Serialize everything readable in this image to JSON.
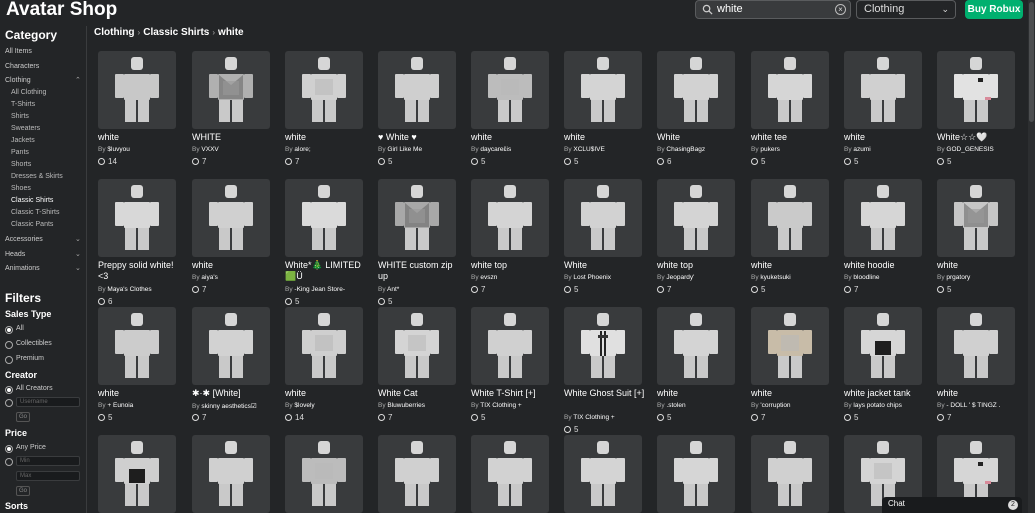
{
  "header": {
    "title": "Avatar Shop",
    "search_value": "white",
    "search_icon": "search-icon",
    "clear_icon": "clear-icon",
    "category_select": "Clothing",
    "buy_robux": "Buy Robux"
  },
  "sidebar": {
    "category_heading": "Category",
    "categories": [
      {
        "label": "All Items"
      },
      {
        "label": "Characters"
      },
      {
        "label": "Clothing"
      }
    ],
    "clothing_sub": [
      {
        "label": "All Clothing"
      },
      {
        "label": "T-Shirts"
      },
      {
        "label": "Shirts"
      },
      {
        "label": "Sweaters"
      },
      {
        "label": "Jackets"
      },
      {
        "label": "Pants"
      },
      {
        "label": "Shorts"
      },
      {
        "label": "Dresses & Skirts"
      },
      {
        "label": "Shoes"
      },
      {
        "label": "Classic Shirts"
      },
      {
        "label": "Classic T-Shirts"
      },
      {
        "label": "Classic Pants"
      }
    ],
    "more_categories": [
      {
        "label": "Accessories"
      },
      {
        "label": "Heads"
      },
      {
        "label": "Animations"
      }
    ],
    "filters_heading": "Filters",
    "sales_type": {
      "heading": "Sales Type",
      "options": [
        "All",
        "Collectibles",
        "Premium"
      ],
      "selected": "All"
    },
    "creator": {
      "heading": "Creator",
      "options": [
        "All Creators"
      ],
      "username_placeholder": "Username",
      "go": "Go"
    },
    "price": {
      "heading": "Price",
      "options": [
        "Any Price"
      ],
      "min_placeholder": "Min",
      "max_placeholder": "Max",
      "go": "Go"
    },
    "sorts_heading": "Sorts"
  },
  "breadcrumb": [
    "Clothing",
    "Classic Shirts",
    "white"
  ],
  "items": [
    {
      "name": "white",
      "creator": "$luvyou",
      "price": "14",
      "shirt": "#c8c8c8",
      "pattern": "none"
    },
    {
      "name": "WHITE",
      "creator": "VXXV",
      "price": "7",
      "shirt": "#b0b0b0",
      "pattern": "dark"
    },
    {
      "name": "white",
      "creator": "alore;",
      "price": "7",
      "shirt": "#d0d0d0",
      "pattern": "light"
    },
    {
      "name": "♥ White ♥",
      "creator": "Girl Like Me",
      "price": "5",
      "shirt": "#cfcfcf",
      "pattern": "none"
    },
    {
      "name": "white",
      "creator": "daycareɛ̈is",
      "price": "5",
      "shirt": "#bcbcbc",
      "pattern": "light"
    },
    {
      "name": "white",
      "creator": "XCLU$IVE",
      "price": "5",
      "shirt": "#d4d4d4",
      "pattern": "none"
    },
    {
      "name": "White",
      "creator": "ChasingBagz",
      "price": "6",
      "shirt": "#d2d2d2",
      "pattern": "none"
    },
    {
      "name": "white tee",
      "creator": "pukers",
      "price": "5",
      "shirt": "#d6d6d6",
      "pattern": "none"
    },
    {
      "name": "white",
      "creator": "azumi",
      "price": "5",
      "shirt": "#d0d0d0",
      "pattern": "none"
    },
    {
      "name": "White☆☆🤍",
      "creator": "GOD_GENESIS",
      "price": "5",
      "shirt": "#e2e2e2",
      "pattern": "accent"
    },
    {
      "name": "Preppy solid white! <3",
      "creator": "Maya's Clothes",
      "price": "6",
      "shirt": "#d8d8d8",
      "pattern": "none"
    },
    {
      "name": "white",
      "creator": "aiya's",
      "price": "7",
      "shirt": "#d0d0d0",
      "pattern": "none"
    },
    {
      "name": "White*🎄 LIMITED🟩Ü",
      "creator": "-King Jean Store-",
      "price": "5",
      "shirt": "#dadada",
      "pattern": "none"
    },
    {
      "name": "WHITE custom zip up",
      "creator": "Ant*",
      "price": "5",
      "shirt": "#a8a8a8",
      "pattern": "dark"
    },
    {
      "name": "white top",
      "creator": "evszn",
      "price": "7",
      "shirt": "#d4d4d4",
      "pattern": "none"
    },
    {
      "name": "White",
      "creator": "Lost Phoenix",
      "price": "5",
      "shirt": "#d2d2d2",
      "pattern": "none"
    },
    {
      "name": "white top",
      "creator": "Jeopardy'",
      "price": "7",
      "shirt": "#d4d4d4",
      "pattern": "none"
    },
    {
      "name": "white",
      "creator": "kyuketsuki",
      "price": "5",
      "shirt": "#cacaca",
      "pattern": "none"
    },
    {
      "name": "white hoodie",
      "creator": "bloodline",
      "price": "7",
      "shirt": "#d6d6d6",
      "pattern": "none"
    },
    {
      "name": "white",
      "creator": "prgatory",
      "price": "5",
      "shirt": "#c6c6c6",
      "pattern": "dark"
    },
    {
      "name": "white",
      "creator": "+ Eunoia",
      "price": "5",
      "shirt": "#cccccc",
      "pattern": "none"
    },
    {
      "name": "✱·✱ [White]",
      "creator": "skinny aesthetics☑",
      "price": "7",
      "shirt": "#d2d2d2",
      "pattern": "none"
    },
    {
      "name": "white",
      "creator": "$lovely",
      "price": "14",
      "shirt": "#cfcfcf",
      "pattern": "light"
    },
    {
      "name": "White Cat",
      "creator": "Bluwuberries",
      "price": "7",
      "shirt": "#d4d4d4",
      "pattern": "light"
    },
    {
      "name": "White T-Shirt [+]",
      "creator": "TIX Clothing +",
      "price": "5",
      "shirt": "#d0d0d0",
      "pattern": "none"
    },
    {
      "name": "White Ghost Suit [+]",
      "creator": "TIX Clothing +",
      "price": "5",
      "shirt": "#e0e0e0",
      "pattern": "suit"
    },
    {
      "name": "white",
      "creator": ".stolen",
      "price": "5",
      "shirt": "#d4d4d4",
      "pattern": "none"
    },
    {
      "name": "white",
      "creator": "'corruption",
      "price": "7",
      "shirt": "#c8bca8",
      "pattern": "light"
    },
    {
      "name": "white jacket tank",
      "creator": "lays potato chips",
      "price": "5",
      "shirt": "#d6d6d6",
      "pattern": "tank"
    },
    {
      "name": "white",
      "creator": "- DOLL ' $ TINGZ .",
      "price": "7",
      "shirt": "#d0d0d0",
      "pattern": "none"
    },
    {
      "name": "",
      "creator": "",
      "price": "",
      "shirt": "#cfcfcf",
      "pattern": "tank"
    },
    {
      "name": "",
      "creator": "",
      "price": "",
      "shirt": "#d0d0d0",
      "pattern": "none"
    },
    {
      "name": "",
      "creator": "",
      "price": "",
      "shirt": "#bcbcbc",
      "pattern": "light"
    },
    {
      "name": "",
      "creator": "",
      "price": "",
      "shirt": "#d0d0d0",
      "pattern": "none"
    },
    {
      "name": "",
      "creator": "",
      "price": "",
      "shirt": "#d2d2d2",
      "pattern": "none"
    },
    {
      "name": "",
      "creator": "",
      "price": "",
      "shirt": "#d4d4d4",
      "pattern": "none"
    },
    {
      "name": "",
      "creator": "",
      "price": "",
      "shirt": "#d6d6d6",
      "pattern": "none"
    },
    {
      "name": "",
      "creator": "",
      "price": "",
      "shirt": "#d0d0d0",
      "pattern": "none"
    },
    {
      "name": "",
      "creator": "",
      "price": "",
      "shirt": "#d4d4d4",
      "pattern": "light"
    },
    {
      "name": "",
      "creator": "",
      "price": "",
      "shirt": "#d6d6d6",
      "pattern": "accent"
    }
  ],
  "by_prefix": "By",
  "robux_icon": "robux-icon",
  "chat": {
    "label": "Chat",
    "badge": "2"
  },
  "colors": {
    "background": "#232527",
    "buy_button": "#00b06f",
    "card": "#393b3d"
  }
}
